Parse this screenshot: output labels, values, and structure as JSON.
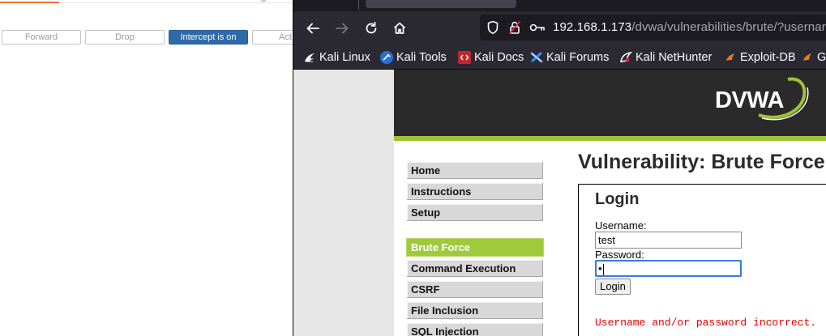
{
  "burp": {
    "buttons": {
      "forward": "Forward",
      "drop": "Drop",
      "intercept": "Intercept is on",
      "action": "Act"
    },
    "accent_color": "#e8712f",
    "intercept_color": "#2f6aa8"
  },
  "browser": {
    "url_host": "192.168.1.173",
    "url_path": "/dvwa/vulnerabilities/brute/?usernar",
    "bookmarks": [
      {
        "label": "Kali Linux",
        "icon": "kali-dragon-icon"
      },
      {
        "label": "Kali Tools",
        "icon": "kali-tools-icon"
      },
      {
        "label": "Kali Docs",
        "icon": "kali-docs-icon"
      },
      {
        "label": "Kali Forums",
        "icon": "kali-forums-icon"
      },
      {
        "label": "Kali NetHunter",
        "icon": "kali-nethunter-icon"
      },
      {
        "label": "Exploit-DB",
        "icon": "exploit-db-icon"
      },
      {
        "label": "G",
        "icon": "ghdb-icon"
      }
    ]
  },
  "dvwa": {
    "logo": "DVWA",
    "menu": [
      "Home",
      "Instructions",
      "Setup",
      "Brute Force",
      "Command Execution",
      "CSRF",
      "File Inclusion",
      "SQL Injection"
    ],
    "selected_menu": "Brute Force",
    "page_title": "Vulnerability: Brute Force",
    "login": {
      "title": "Login",
      "username_label": "Username:",
      "username_value": "test",
      "password_label": "Password:",
      "password_value": "•",
      "submit": "Login",
      "error": "Username and/or password incorrect."
    },
    "accent_color": "#9fc237"
  }
}
